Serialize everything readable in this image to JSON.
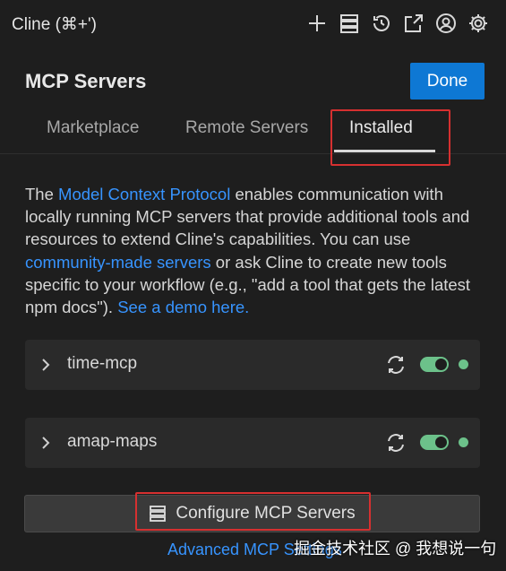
{
  "titlebar": {
    "title": "Cline (⌘+')",
    "icons": [
      "plus-icon",
      "server-list-icon",
      "history-icon",
      "popout-icon",
      "account-icon",
      "gear-icon"
    ]
  },
  "header": {
    "title": "MCP Servers",
    "done_label": "Done"
  },
  "tabs": [
    {
      "label": "Marketplace",
      "active": false
    },
    {
      "label": "Remote Servers",
      "active": false
    },
    {
      "label": "Installed",
      "active": true
    }
  ],
  "description": {
    "p1": "The ",
    "link1": "Model Context Protocol",
    "p2": " enables communication with locally running MCP servers that provide additional tools and resources to extend Cline's capabilities. You can use ",
    "link2": "community-made servers",
    "p3": " or ask Cline to create new tools specific to your workflow (e.g., \"add a tool that gets the latest npm docs\"). ",
    "link3": "See a demo here."
  },
  "servers": [
    {
      "name": "time-mcp",
      "enabled": true,
      "status_color": "#6cc18a"
    },
    {
      "name": "amap-maps",
      "enabled": true,
      "status_color": "#6cc18a"
    }
  ],
  "configure_label": "Configure MCP Servers",
  "advanced_link": "Advanced MCP Settings",
  "watermark": "掘金技术社区 @ 我想说一句",
  "colors": {
    "accent": "#0e78d4",
    "link": "#3794ff",
    "status_ok": "#6cc18a",
    "highlight": "#d63030"
  }
}
